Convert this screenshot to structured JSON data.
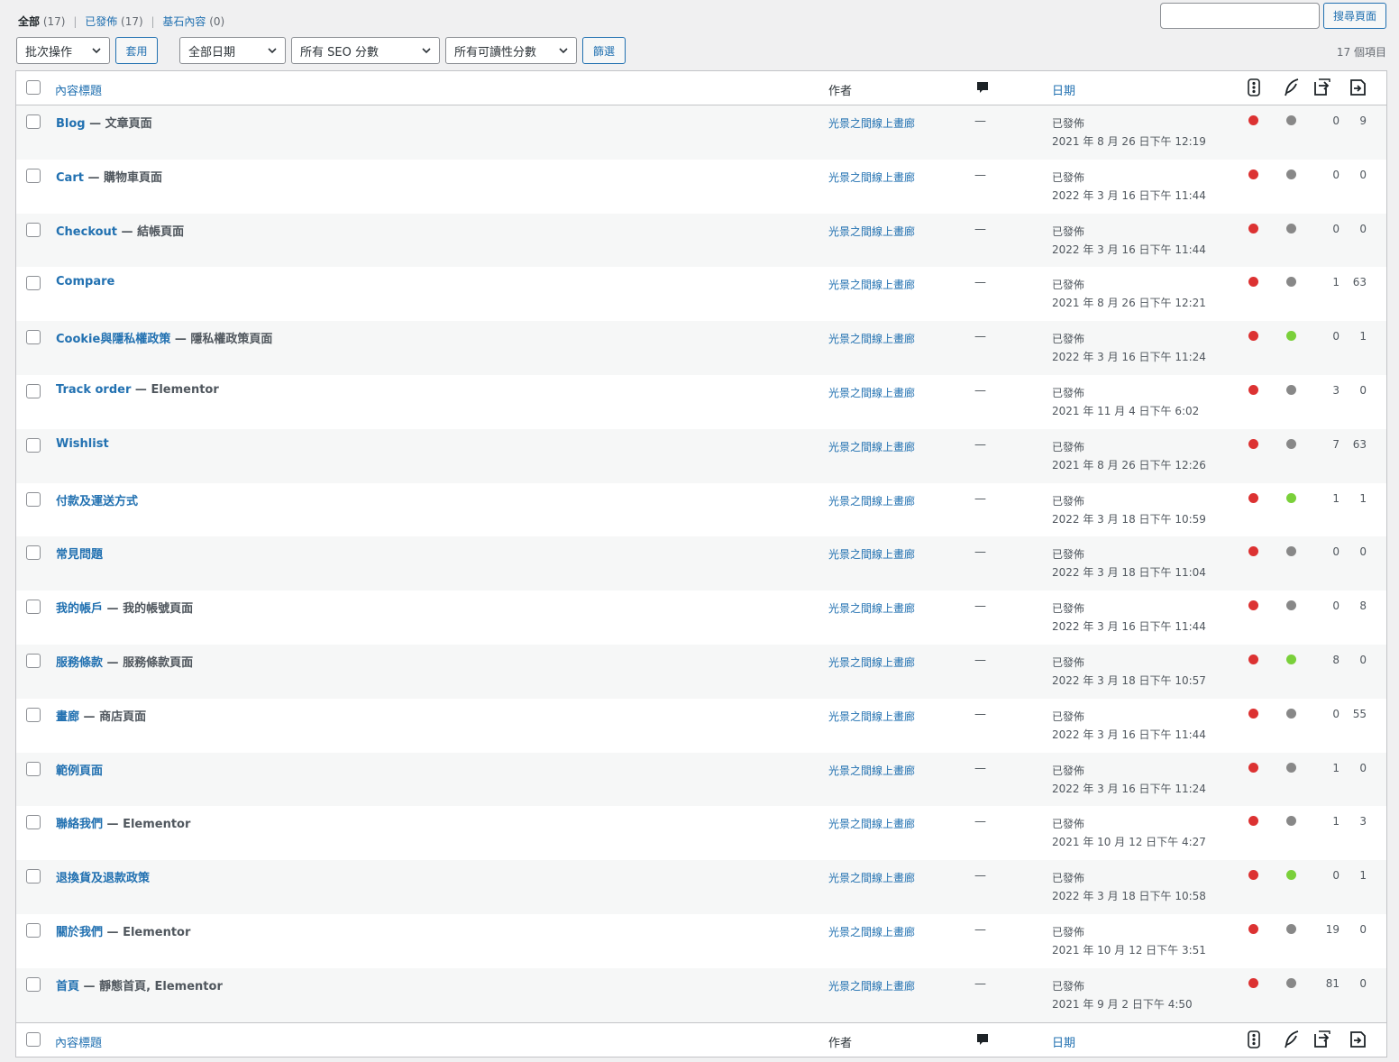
{
  "views": {
    "all": {
      "label": "全部",
      "count": "(17)"
    },
    "publish": {
      "label": "已發佈",
      "count": "(17)"
    },
    "trash": {
      "label": "基石內容",
      "count": "(0)"
    }
  },
  "search": {
    "placeholder": "",
    "button": "搜尋頁面"
  },
  "tablenav": {
    "bulk_action": "批次操作",
    "apply": "套用",
    "date_filter": "全部日期",
    "seo_filter": "所有 SEO 分數",
    "readability_filter": "所有可讀性分數",
    "filter": "篩選",
    "item_count": "17 個項目"
  },
  "columns": {
    "title": "內容標題",
    "author": "作者",
    "date": "日期"
  },
  "colors": {
    "red": "#dc3232",
    "gray": "#888888",
    "green": "#7ad03a",
    "link": "#2271b1"
  },
  "rows": [
    {
      "title": "Blog",
      "state": " — 文章頁面",
      "author": "光景之間線上畫廊",
      "comments": "—",
      "status": "已發佈",
      "date": "2021 年 8 月 26 日下午 12:19",
      "seo": "red",
      "read": "gray",
      "links_in": "0",
      "links_out": "9"
    },
    {
      "title": "Cart",
      "state": " — 購物車頁面",
      "author": "光景之間線上畫廊",
      "comments": "—",
      "status": "已發佈",
      "date": "2022 年 3 月 16 日下午 11:44",
      "seo": "red",
      "read": "gray",
      "links_in": "0",
      "links_out": "0"
    },
    {
      "title": "Checkout",
      "state": " — 結帳頁面",
      "author": "光景之間線上畫廊",
      "comments": "—",
      "status": "已發佈",
      "date": "2022 年 3 月 16 日下午 11:44",
      "seo": "red",
      "read": "gray",
      "links_in": "0",
      "links_out": "0"
    },
    {
      "title": "Compare",
      "state": "",
      "author": "光景之間線上畫廊",
      "comments": "—",
      "status": "已發佈",
      "date": "2021 年 8 月 26 日下午 12:21",
      "seo": "red",
      "read": "gray",
      "links_in": "1",
      "links_out": "63"
    },
    {
      "title": "Cookie與隱私權政策",
      "state": " — 隱私權政策頁面",
      "author": "光景之間線上畫廊",
      "comments": "—",
      "status": "已發佈",
      "date": "2022 年 3 月 16 日下午 11:24",
      "seo": "red",
      "read": "green",
      "links_in": "0",
      "links_out": "1"
    },
    {
      "title": "Track order",
      "state": " — Elementor",
      "author": "光景之間線上畫廊",
      "comments": "—",
      "status": "已發佈",
      "date": "2021 年 11 月 4 日下午 6:02",
      "seo": "red",
      "read": "gray",
      "links_in": "3",
      "links_out": "0"
    },
    {
      "title": "Wishlist",
      "state": "",
      "author": "光景之間線上畫廊",
      "comments": "—",
      "status": "已發佈",
      "date": "2021 年 8 月 26 日下午 12:26",
      "seo": "red",
      "read": "gray",
      "links_in": "7",
      "links_out": "63"
    },
    {
      "title": "付款及運送方式",
      "state": "",
      "author": "光景之間線上畫廊",
      "comments": "—",
      "status": "已發佈",
      "date": "2022 年 3 月 18 日下午 10:59",
      "seo": "red",
      "read": "green",
      "links_in": "1",
      "links_out": "1"
    },
    {
      "title": "常見問題",
      "state": "",
      "author": "光景之間線上畫廊",
      "comments": "—",
      "status": "已發佈",
      "date": "2022 年 3 月 18 日下午 11:04",
      "seo": "red",
      "read": "gray",
      "links_in": "0",
      "links_out": "0"
    },
    {
      "title": "我的帳戶",
      "state": " — 我的帳號頁面",
      "author": "光景之間線上畫廊",
      "comments": "—",
      "status": "已發佈",
      "date": "2022 年 3 月 16 日下午 11:44",
      "seo": "red",
      "read": "gray",
      "links_in": "0",
      "links_out": "8"
    },
    {
      "title": "服務條款",
      "state": " — 服務條款頁面",
      "author": "光景之間線上畫廊",
      "comments": "—",
      "status": "已發佈",
      "date": "2022 年 3 月 18 日下午 10:57",
      "seo": "red",
      "read": "green",
      "links_in": "8",
      "links_out": "0"
    },
    {
      "title": "畫廊",
      "state": " — 商店頁面",
      "author": "光景之間線上畫廊",
      "comments": "—",
      "status": "已發佈",
      "date": "2022 年 3 月 16 日下午 11:44",
      "seo": "red",
      "read": "gray",
      "links_in": "0",
      "links_out": "55"
    },
    {
      "title": "範例頁面",
      "state": "",
      "author": "光景之間線上畫廊",
      "comments": "—",
      "status": "已發佈",
      "date": "2022 年 3 月 16 日下午 11:24",
      "seo": "red",
      "read": "gray",
      "links_in": "1",
      "links_out": "0"
    },
    {
      "title": "聯絡我們",
      "state": " — Elementor",
      "author": "光景之間線上畫廊",
      "comments": "—",
      "status": "已發佈",
      "date": "2021 年 10 月 12 日下午 4:27",
      "seo": "red",
      "read": "gray",
      "links_in": "1",
      "links_out": "3"
    },
    {
      "title": "退換貨及退款政策",
      "state": "",
      "author": "光景之間線上畫廊",
      "comments": "—",
      "status": "已發佈",
      "date": "2022 年 3 月 18 日下午 10:58",
      "seo": "red",
      "read": "green",
      "links_in": "0",
      "links_out": "1"
    },
    {
      "title": "關於我們",
      "state": " — Elementor",
      "author": "光景之間線上畫廊",
      "comments": "—",
      "status": "已發佈",
      "date": "2021 年 10 月 12 日下午 3:51",
      "seo": "red",
      "read": "gray",
      "links_in": "19",
      "links_out": "0"
    },
    {
      "title": "首頁",
      "state": " — 靜態首頁, Elementor",
      "author": "光景之間線上畫廊",
      "comments": "—",
      "status": "已發佈",
      "date": "2021 年 9 月 2 日下午 4:50",
      "seo": "red",
      "read": "gray",
      "links_in": "81",
      "links_out": "0"
    }
  ]
}
